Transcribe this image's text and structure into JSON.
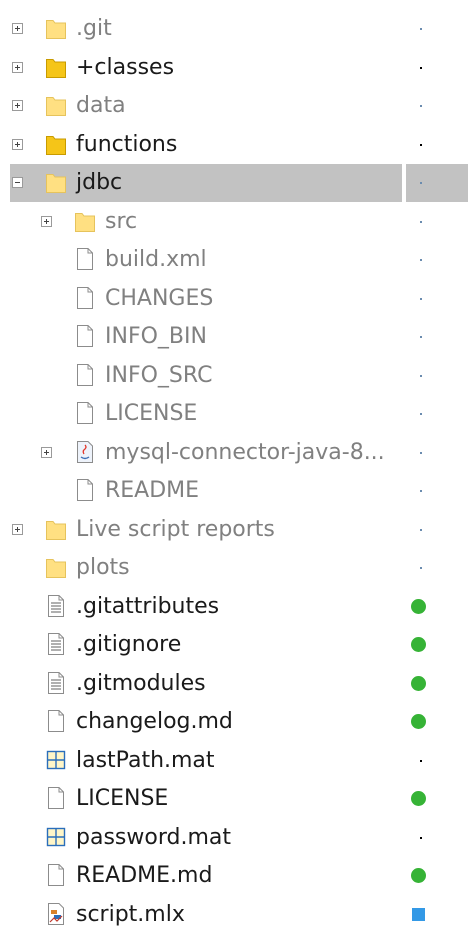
{
  "colors": {
    "selection": "#c2c2c2",
    "status_green": "#36b336",
    "status_blue": "#3399e6",
    "folder_light": "#ffe082",
    "folder_dark": "#f5c518",
    "mat_icon": "#2a6ebb"
  },
  "tree": [
    {
      "label": ".git",
      "icon": "folder-icon",
      "icon_shade": "light",
      "depth": 0,
      "expander": "plus",
      "text": "grey",
      "status": "dot-grey"
    },
    {
      "label": "+classes",
      "icon": "folder-icon",
      "icon_shade": "dark",
      "depth": 0,
      "expander": "plus",
      "text": "dark",
      "status": "dot-dark"
    },
    {
      "label": "data",
      "icon": "folder-icon",
      "icon_shade": "light",
      "depth": 0,
      "expander": "plus",
      "text": "grey",
      "status": "dot-grey"
    },
    {
      "label": "functions",
      "icon": "folder-icon",
      "icon_shade": "dark",
      "depth": 0,
      "expander": "plus",
      "text": "dark",
      "status": "dot-dark"
    },
    {
      "label": "jdbc",
      "icon": "folder-icon",
      "icon_shade": "light",
      "depth": 0,
      "expander": "minus",
      "text": "dark",
      "status": "dot-grey",
      "selected": true
    },
    {
      "label": "src",
      "icon": "folder-icon",
      "icon_shade": "light",
      "depth": 1,
      "expander": "plus",
      "text": "grey",
      "status": "dot-grey"
    },
    {
      "label": "build.xml",
      "icon": "file-icon",
      "depth": 1,
      "expander": "none",
      "text": "grey",
      "status": "dot-grey"
    },
    {
      "label": "CHANGES",
      "icon": "file-icon",
      "depth": 1,
      "expander": "none",
      "text": "grey",
      "status": "dot-grey"
    },
    {
      "label": "INFO_BIN",
      "icon": "file-icon",
      "depth": 1,
      "expander": "none",
      "text": "grey",
      "status": "dot-grey"
    },
    {
      "label": "INFO_SRC",
      "icon": "file-icon",
      "depth": 1,
      "expander": "none",
      "text": "grey",
      "status": "dot-grey"
    },
    {
      "label": "LICENSE",
      "icon": "file-icon",
      "depth": 1,
      "expander": "none",
      "text": "grey",
      "status": "dot-grey"
    },
    {
      "label": "mysql-connector-java-8...",
      "icon": "java-archive-icon",
      "depth": 1,
      "expander": "plus",
      "text": "grey",
      "status": "dot-grey"
    },
    {
      "label": "README",
      "icon": "file-icon",
      "depth": 1,
      "expander": "none",
      "text": "grey",
      "status": "dot-grey"
    },
    {
      "label": "Live script reports",
      "icon": "folder-icon",
      "icon_shade": "light",
      "depth": 0,
      "expander": "plus",
      "text": "grey",
      "status": "dot-grey"
    },
    {
      "label": "plots",
      "icon": "folder-icon",
      "icon_shade": "light",
      "depth": 0,
      "expander": "none",
      "text": "grey",
      "status": "dot-grey"
    },
    {
      "label": ".gitattributes",
      "icon": "text-file-icon",
      "depth": 0,
      "expander": "none",
      "text": "dark",
      "status": "green"
    },
    {
      "label": ".gitignore",
      "icon": "text-file-icon",
      "depth": 0,
      "expander": "none",
      "text": "dark",
      "status": "green"
    },
    {
      "label": ".gitmodules",
      "icon": "text-file-icon",
      "depth": 0,
      "expander": "none",
      "text": "dark",
      "status": "green"
    },
    {
      "label": "changelog.md",
      "icon": "file-icon",
      "depth": 0,
      "expander": "none",
      "text": "dark",
      "status": "green"
    },
    {
      "label": "lastPath.mat",
      "icon": "mat-file-icon",
      "depth": 0,
      "expander": "none",
      "text": "dark",
      "status": "dot-dark"
    },
    {
      "label": "LICENSE",
      "icon": "file-icon",
      "depth": 0,
      "expander": "none",
      "text": "dark",
      "status": "green"
    },
    {
      "label": "password.mat",
      "icon": "mat-file-icon",
      "depth": 0,
      "expander": "none",
      "text": "dark",
      "status": "dot-dark"
    },
    {
      "label": "README.md",
      "icon": "file-icon",
      "depth": 0,
      "expander": "none",
      "text": "dark",
      "status": "green"
    },
    {
      "label": "script.mlx",
      "icon": "live-script-icon",
      "depth": 0,
      "expander": "none",
      "text": "dark",
      "status": "blue"
    }
  ]
}
